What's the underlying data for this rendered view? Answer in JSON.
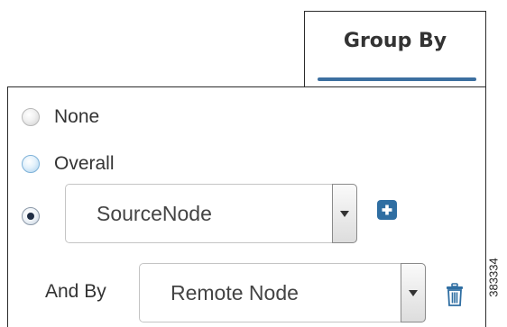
{
  "tab": {
    "label": "Group By",
    "underline_color": "#3c6fa0"
  },
  "options": [
    {
      "label": "None",
      "selected": false
    },
    {
      "label": "Overall",
      "selected": false
    },
    {
      "label": "",
      "selected": true
    }
  ],
  "group_by_select": {
    "value": "SourceNode",
    "icon": "chevron-down-icon"
  },
  "add_button": {
    "icon": "plus-icon",
    "color": "#2f6ea2"
  },
  "and_by": {
    "label": "And By",
    "select": {
      "value": "Remote Node",
      "icon": "chevron-down-icon"
    },
    "delete_icon": "trash-icon",
    "delete_color": "#2f6ea2"
  },
  "figure_id": "383334"
}
